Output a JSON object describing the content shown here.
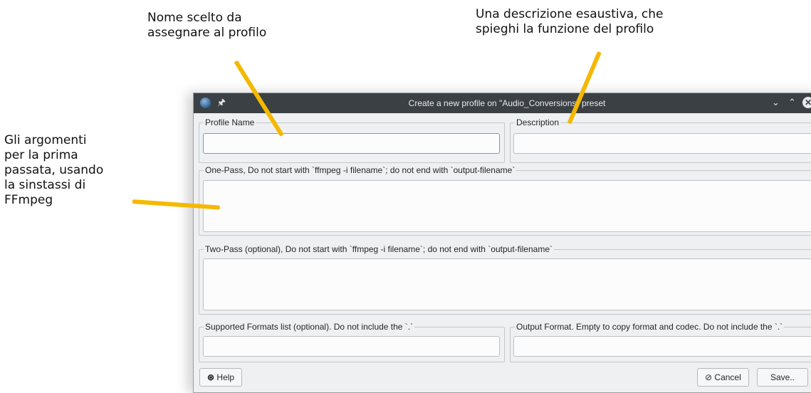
{
  "annotations": {
    "profile_name": "Nome scelto da\nassegnare al profilo",
    "description": "Una descrizione esaustiva, che\nspieghi la funzione del profilo",
    "arguments": "Gli argomenti\nper la prima\npassata, usando\nla sinstassi di\nFFmpeg"
  },
  "window": {
    "title": "Create a new profile on \"Audio_Conversions\" preset",
    "controls": [
      "minimize",
      "maximize",
      "close"
    ]
  },
  "form": {
    "profile_name": {
      "label": "Profile Name",
      "value": ""
    },
    "description": {
      "label": "Description",
      "value": ""
    },
    "one_pass": {
      "label": "One-Pass, Do not start with `ffmpeg -i filename`; do not end with `output-filename`",
      "value": ""
    },
    "two_pass": {
      "label": "Two-Pass (optional), Do not start with `ffmpeg -i filename`; do not end with `output-filename`",
      "value": ""
    },
    "supported_formats": {
      "label": "Supported Formats list (optional). Do not include the `.`",
      "value": ""
    },
    "output_format": {
      "label": "Output Format. Empty to copy format and codec. Do not include the `.`",
      "value": ""
    }
  },
  "buttons": {
    "help": "Help",
    "cancel": "Cancel",
    "save": "Save.."
  },
  "colors": {
    "annotation_line": "#f5b800",
    "titlebar": "#3b4045",
    "focus": "#3daee9"
  }
}
